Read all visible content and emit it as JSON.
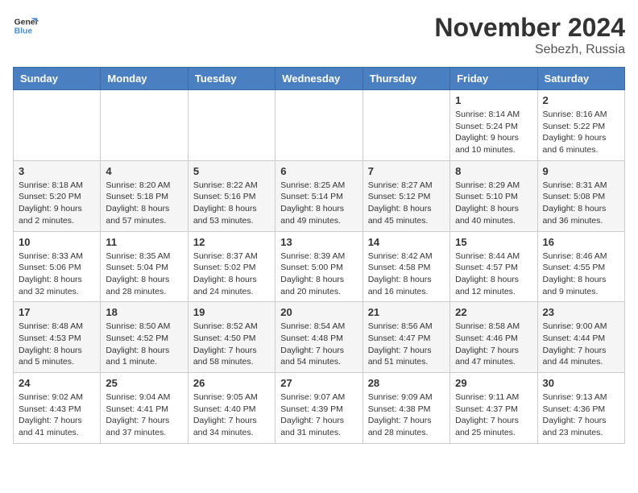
{
  "logo": {
    "line1": "General",
    "line2": "Blue"
  },
  "title": "November 2024",
  "location": "Sebezh, Russia",
  "weekdays": [
    "Sunday",
    "Monday",
    "Tuesday",
    "Wednesday",
    "Thursday",
    "Friday",
    "Saturday"
  ],
  "weeks": [
    [
      {
        "day": "",
        "info": ""
      },
      {
        "day": "",
        "info": ""
      },
      {
        "day": "",
        "info": ""
      },
      {
        "day": "",
        "info": ""
      },
      {
        "day": "",
        "info": ""
      },
      {
        "day": "1",
        "info": "Sunrise: 8:14 AM\nSunset: 5:24 PM\nDaylight: 9 hours and 10 minutes."
      },
      {
        "day": "2",
        "info": "Sunrise: 8:16 AM\nSunset: 5:22 PM\nDaylight: 9 hours and 6 minutes."
      }
    ],
    [
      {
        "day": "3",
        "info": "Sunrise: 8:18 AM\nSunset: 5:20 PM\nDaylight: 9 hours and 2 minutes."
      },
      {
        "day": "4",
        "info": "Sunrise: 8:20 AM\nSunset: 5:18 PM\nDaylight: 8 hours and 57 minutes."
      },
      {
        "day": "5",
        "info": "Sunrise: 8:22 AM\nSunset: 5:16 PM\nDaylight: 8 hours and 53 minutes."
      },
      {
        "day": "6",
        "info": "Sunrise: 8:25 AM\nSunset: 5:14 PM\nDaylight: 8 hours and 49 minutes."
      },
      {
        "day": "7",
        "info": "Sunrise: 8:27 AM\nSunset: 5:12 PM\nDaylight: 8 hours and 45 minutes."
      },
      {
        "day": "8",
        "info": "Sunrise: 8:29 AM\nSunset: 5:10 PM\nDaylight: 8 hours and 40 minutes."
      },
      {
        "day": "9",
        "info": "Sunrise: 8:31 AM\nSunset: 5:08 PM\nDaylight: 8 hours and 36 minutes."
      }
    ],
    [
      {
        "day": "10",
        "info": "Sunrise: 8:33 AM\nSunset: 5:06 PM\nDaylight: 8 hours and 32 minutes."
      },
      {
        "day": "11",
        "info": "Sunrise: 8:35 AM\nSunset: 5:04 PM\nDaylight: 8 hours and 28 minutes."
      },
      {
        "day": "12",
        "info": "Sunrise: 8:37 AM\nSunset: 5:02 PM\nDaylight: 8 hours and 24 minutes."
      },
      {
        "day": "13",
        "info": "Sunrise: 8:39 AM\nSunset: 5:00 PM\nDaylight: 8 hours and 20 minutes."
      },
      {
        "day": "14",
        "info": "Sunrise: 8:42 AM\nSunset: 4:58 PM\nDaylight: 8 hours and 16 minutes."
      },
      {
        "day": "15",
        "info": "Sunrise: 8:44 AM\nSunset: 4:57 PM\nDaylight: 8 hours and 12 minutes."
      },
      {
        "day": "16",
        "info": "Sunrise: 8:46 AM\nSunset: 4:55 PM\nDaylight: 8 hours and 9 minutes."
      }
    ],
    [
      {
        "day": "17",
        "info": "Sunrise: 8:48 AM\nSunset: 4:53 PM\nDaylight: 8 hours and 5 minutes."
      },
      {
        "day": "18",
        "info": "Sunrise: 8:50 AM\nSunset: 4:52 PM\nDaylight: 8 hours and 1 minute."
      },
      {
        "day": "19",
        "info": "Sunrise: 8:52 AM\nSunset: 4:50 PM\nDaylight: 7 hours and 58 minutes."
      },
      {
        "day": "20",
        "info": "Sunrise: 8:54 AM\nSunset: 4:48 PM\nDaylight: 7 hours and 54 minutes."
      },
      {
        "day": "21",
        "info": "Sunrise: 8:56 AM\nSunset: 4:47 PM\nDaylight: 7 hours and 51 minutes."
      },
      {
        "day": "22",
        "info": "Sunrise: 8:58 AM\nSunset: 4:46 PM\nDaylight: 7 hours and 47 minutes."
      },
      {
        "day": "23",
        "info": "Sunrise: 9:00 AM\nSunset: 4:44 PM\nDaylight: 7 hours and 44 minutes."
      }
    ],
    [
      {
        "day": "24",
        "info": "Sunrise: 9:02 AM\nSunset: 4:43 PM\nDaylight: 7 hours and 41 minutes."
      },
      {
        "day": "25",
        "info": "Sunrise: 9:04 AM\nSunset: 4:41 PM\nDaylight: 7 hours and 37 minutes."
      },
      {
        "day": "26",
        "info": "Sunrise: 9:05 AM\nSunset: 4:40 PM\nDaylight: 7 hours and 34 minutes."
      },
      {
        "day": "27",
        "info": "Sunrise: 9:07 AM\nSunset: 4:39 PM\nDaylight: 7 hours and 31 minutes."
      },
      {
        "day": "28",
        "info": "Sunrise: 9:09 AM\nSunset: 4:38 PM\nDaylight: 7 hours and 28 minutes."
      },
      {
        "day": "29",
        "info": "Sunrise: 9:11 AM\nSunset: 4:37 PM\nDaylight: 7 hours and 25 minutes."
      },
      {
        "day": "30",
        "info": "Sunrise: 9:13 AM\nSunset: 4:36 PM\nDaylight: 7 hours and 23 minutes."
      }
    ]
  ]
}
